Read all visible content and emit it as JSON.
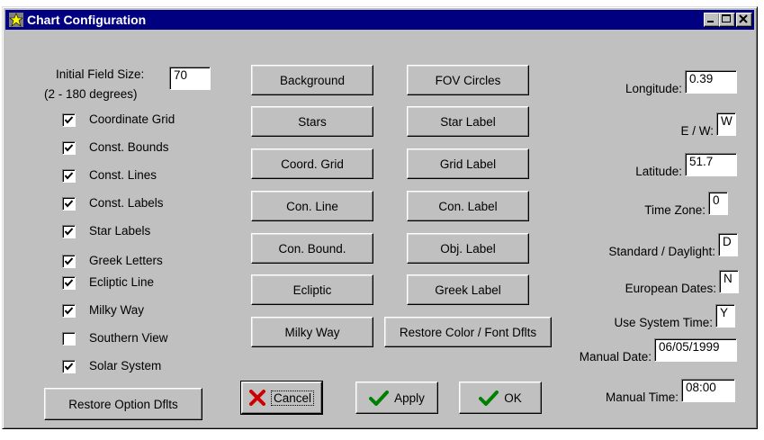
{
  "window": {
    "title": "Chart Configuration"
  },
  "field_size": {
    "label_line1": "Initial Field Size:",
    "label_line2": "(2 - 180 degrees)",
    "value": "70"
  },
  "options": [
    {
      "label": "Coordinate Grid",
      "checked": true
    },
    {
      "label": "Const. Bounds",
      "checked": true
    },
    {
      "label": "Const. Lines",
      "checked": true
    },
    {
      "label": "Const. Labels",
      "checked": true
    },
    {
      "label": "Star Labels",
      "checked": true
    },
    {
      "label": "Greek Letters",
      "checked": true
    },
    {
      "label": "Ecliptic Line",
      "checked": true
    },
    {
      "label": "Milky Way",
      "checked": true
    },
    {
      "label": "Southern View",
      "checked": false
    },
    {
      "label": "Solar System",
      "checked": true
    }
  ],
  "restore_option_label": "Restore Option Dflts",
  "color_buttons_left": [
    "Background",
    "Stars",
    "Coord. Grid",
    "Con. Line",
    "Con. Bound.",
    "Ecliptic",
    "Milky Way"
  ],
  "color_buttons_right": [
    "FOV Circles",
    "Star Label",
    "Grid Label",
    "Con. Label",
    "Obj. Label",
    "Greek Label",
    "Restore Color / Font Dflts"
  ],
  "settings": [
    {
      "label": "Longitude:",
      "value": "0.39"
    },
    {
      "label": "E / W:",
      "value": "W"
    },
    {
      "label": "Latitude:",
      "value": "51.7"
    },
    {
      "label": "Time Zone:",
      "value": "0"
    },
    {
      "label": "Standard / Daylight:",
      "value": "D"
    },
    {
      "label": "European Dates:",
      "value": "N"
    },
    {
      "label": "Use System Time:",
      "value": "Y"
    },
    {
      "label": "Manual Date:",
      "value": "06/05/1999"
    },
    {
      "label": "Manual Time:",
      "value": "08:00"
    }
  ],
  "actions": {
    "cancel": "Cancel",
    "apply": "Apply",
    "ok": "OK"
  },
  "colors": {
    "titlebar": "#000080",
    "face": "#c0c0c0",
    "cancel_x": "#cc0000",
    "check_green": "#008000"
  },
  "icons": {
    "title": "star-chart-icon",
    "cancel": "red-x-icon",
    "apply": "green-check-icon",
    "ok": "green-check-icon"
  }
}
